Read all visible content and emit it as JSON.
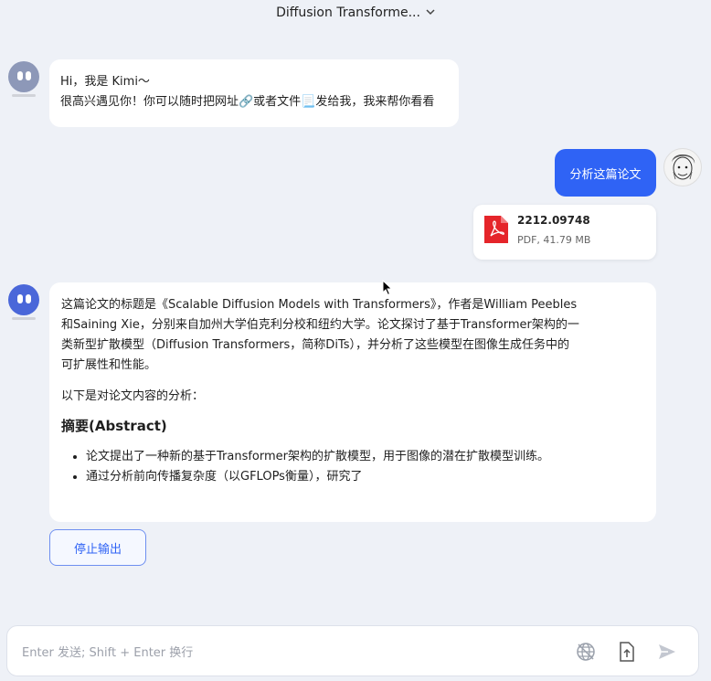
{
  "header": {
    "title": "Diffusion Transforme...",
    "dropdown_icon": "chevron-down-icon"
  },
  "messages": {
    "greeting": {
      "line1": "Hi，我是 Kimi～",
      "line2": "很高兴遇见你！你可以随时把网址🔗或者文件📃发给我，我来帮你看看"
    },
    "user": {
      "text": "分析这篇论文"
    },
    "file": {
      "name": "2212.09748",
      "meta": "PDF, 41.79 MB"
    },
    "answer": {
      "intro_lines": [
        "这篇论文的标题是《Scalable Diffusion Models with Transformers》，作者是William Peebles",
        "和Saining Xie，分别来自加州大学伯克利分校和纽约大学。论文探讨了基于Transformer架构的一",
        "类新型扩散模型（Diffusion Transformers，简称DiTs），并分析了这些模型在图像生成任务中的",
        "可扩展性和性能。"
      ],
      "lead": "以下是对论文内容的分析：",
      "heading": "摘要(Abstract)",
      "bullets": [
        "论文提出了一种新的基于Transformer架构的扩散模型，用于图像的潜在扩散模型训练。",
        "通过分析前向传播复杂度（以GFLOPs衡量），研究了"
      ]
    }
  },
  "stop_button": {
    "label": "停止输出"
  },
  "input": {
    "placeholder": "Enter 发送; Shift + Enter 换行",
    "value": ""
  },
  "colors": {
    "accent": "#2f63f5",
    "background": "#eef1f7"
  }
}
